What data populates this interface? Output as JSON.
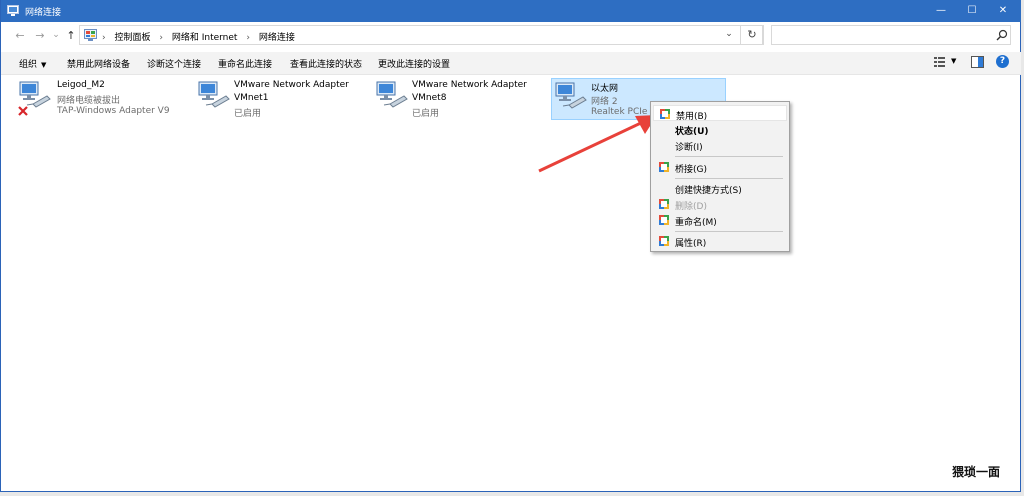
{
  "window": {
    "title": "网络连接",
    "minimize_glyph": "—",
    "maximize_glyph": "☐",
    "close_glyph": "✕"
  },
  "nav": {
    "back_glyph": "←",
    "forward_glyph": "→",
    "recent_glyph": "⌄",
    "up_glyph": "↑"
  },
  "address": {
    "breadcrumbs": [
      "控制面板",
      "网络和 Internet",
      "网络连接"
    ],
    "separator": "›",
    "dropdown_glyph": "⌄",
    "refresh_glyph": "↻"
  },
  "search": {
    "value": "",
    "placeholder": "",
    "icon": "search-icon"
  },
  "commandbar": {
    "organize": "组织",
    "disable_device": "禁用此网络设备",
    "diagnose": "诊断这个连接",
    "rename": "重命名此连接",
    "view_status": "查看此连接的状态",
    "change_settings": "更改此连接的设置"
  },
  "connections": [
    {
      "name": "Leigod_M2",
      "status": "网络电缆被拔出",
      "device": "TAP-Windows Adapter V9",
      "disconnected": true
    },
    {
      "name": "VMware Network Adapter",
      "status": "VMnet1",
      "device": "已启用",
      "disconnected": false
    },
    {
      "name": "VMware Network Adapter",
      "status": "VMnet8",
      "device": "已启用",
      "disconnected": false
    },
    {
      "name": "以太网",
      "status": "网络 2",
      "device": "Realtek PCIe G",
      "disconnected": false,
      "selected": true
    }
  ],
  "context_menu": {
    "items": [
      {
        "label": "禁用(B)"
      },
      {
        "label": "状态(U)"
      },
      {
        "label": "诊断(I)"
      },
      {
        "label": "桥接(G)"
      },
      {
        "label": "创建快捷方式(S)"
      },
      {
        "label": "删除(D)"
      },
      {
        "label": "重命名(M)"
      },
      {
        "label": "属性(R)"
      }
    ]
  },
  "watermark": "猥琐一面",
  "colors": {
    "titlebar": "#2e6ec2",
    "selection": "#cce8ff",
    "arrow": "#e8413a"
  }
}
